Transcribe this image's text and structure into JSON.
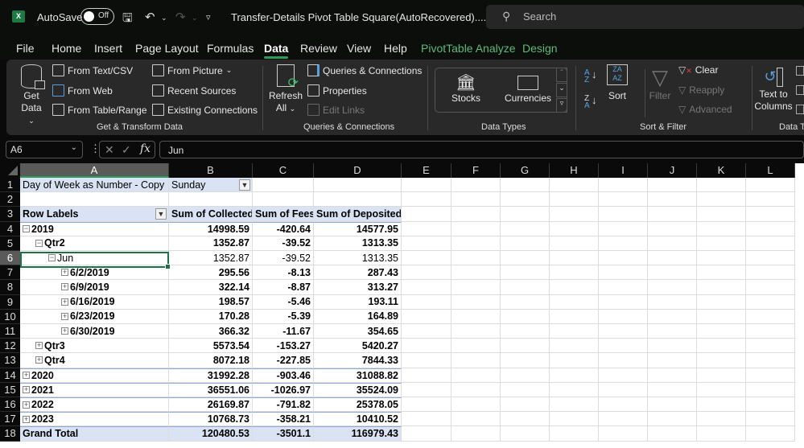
{
  "titlebar": {
    "app_icon": "excel-icon",
    "autosave_label": "AutoSave",
    "autosave_state": "Off",
    "doc_title": "Transfer-Details Pivot Table Square(AutoRecovered)....",
    "search_placeholder": "Search"
  },
  "tabs": [
    {
      "label": "File"
    },
    {
      "label": "Home"
    },
    {
      "label": "Insert"
    },
    {
      "label": "Page Layout"
    },
    {
      "label": "Formulas"
    },
    {
      "label": "Data",
      "active": true
    },
    {
      "label": "Review"
    },
    {
      "label": "View"
    },
    {
      "label": "Help"
    },
    {
      "label": "PivotTable Analyze",
      "contextual": true
    },
    {
      "label": "Design",
      "contextual": true
    }
  ],
  "ribbon": {
    "get_transform": {
      "group_label": "Get & Transform Data",
      "get_data_line1": "Get",
      "get_data_line2": "Data",
      "from_text_csv": "From Text/CSV",
      "from_web": "From Web",
      "from_table_range": "From Table/Range",
      "from_picture": "From Picture",
      "recent_sources": "Recent Sources",
      "existing_connections": "Existing Connections"
    },
    "queries": {
      "group_label": "Queries & Connections",
      "refresh_line1": "Refresh",
      "refresh_line2": "All",
      "queries_connections": "Queries & Connections",
      "properties": "Properties",
      "edit_links": "Edit Links"
    },
    "data_types": {
      "group_label": "Data Types",
      "stocks": "Stocks",
      "currencies": "Currencies"
    },
    "sort_filter": {
      "group_label": "Sort & Filter",
      "sort": "Sort",
      "filter": "Filter",
      "clear": "Clear",
      "reapply": "Reapply",
      "advanced": "Advanced"
    },
    "data_tools": {
      "group_label": "Data To",
      "text_to_columns_line1": "Text to",
      "text_to_columns_line2": "Columns"
    }
  },
  "formula_bar": {
    "name_box": "A6",
    "formula": "Jun"
  },
  "columns": [
    "A",
    "B",
    "C",
    "D",
    "E",
    "F",
    "G",
    "H",
    "I",
    "J",
    "K",
    "L"
  ],
  "rows": [
    "1",
    "2",
    "3",
    "4",
    "5",
    "6",
    "7",
    "8",
    "9",
    "10",
    "11",
    "12",
    "13",
    "14",
    "15",
    "16",
    "17",
    "18"
  ],
  "pivot": {
    "filter_label": "Day of Week as Number - Copy",
    "filter_value": "Sunday",
    "headers": [
      "Row Labels",
      "Sum of Collected",
      "Sum of Fees",
      "Sum of Deposited"
    ],
    "rows": [
      {
        "label": "2019",
        "collected": "14998.59",
        "fees": "-420.64",
        "deposited": "14577.95",
        "level": 0,
        "toggle": "minus",
        "bold": true
      },
      {
        "label": "Qtr2",
        "collected": "1352.87",
        "fees": "-39.52",
        "deposited": "1313.35",
        "level": 1,
        "toggle": "minus",
        "bold": true
      },
      {
        "label": "Jun",
        "collected": "1352.87",
        "fees": "-39.52",
        "deposited": "1313.35",
        "level": 2,
        "toggle": "minus",
        "bold": false
      },
      {
        "label": "6/2/2019",
        "collected": "295.56",
        "fees": "-8.13",
        "deposited": "287.43",
        "level": 3,
        "toggle": "plus",
        "bold": true
      },
      {
        "label": "6/9/2019",
        "collected": "322.14",
        "fees": "-8.87",
        "deposited": "313.27",
        "level": 3,
        "toggle": "plus",
        "bold": true
      },
      {
        "label": "6/16/2019",
        "collected": "198.57",
        "fees": "-5.46",
        "deposited": "193.11",
        "level": 3,
        "toggle": "plus",
        "bold": true
      },
      {
        "label": "6/23/2019",
        "collected": "170.28",
        "fees": "-5.39",
        "deposited": "164.89",
        "level": 3,
        "toggle": "plus",
        "bold": true
      },
      {
        "label": "6/30/2019",
        "collected": "366.32",
        "fees": "-11.67",
        "deposited": "354.65",
        "level": 3,
        "toggle": "plus",
        "bold": true
      },
      {
        "label": "Qtr3",
        "collected": "5573.54",
        "fees": "-153.27",
        "deposited": "5420.27",
        "level": 1,
        "toggle": "plus",
        "bold": true
      },
      {
        "label": "Qtr4",
        "collected": "8072.18",
        "fees": "-227.85",
        "deposited": "7844.33",
        "level": 1,
        "toggle": "plus",
        "bold": true
      },
      {
        "label": "2020",
        "collected": "31992.28",
        "fees": "-903.46",
        "deposited": "31088.82",
        "level": 0,
        "toggle": "plus",
        "bold": true
      },
      {
        "label": "2021",
        "collected": "36551.06",
        "fees": "-1026.97",
        "deposited": "35524.09",
        "level": 0,
        "toggle": "plus",
        "bold": true
      },
      {
        "label": "2022",
        "collected": "26169.87",
        "fees": "-791.82",
        "deposited": "25378.05",
        "level": 0,
        "toggle": "plus",
        "bold": true
      },
      {
        "label": "2023",
        "collected": "10768.73",
        "fees": "-358.21",
        "deposited": "10410.52",
        "level": 0,
        "toggle": "plus",
        "bold": true
      }
    ],
    "grand_total": {
      "label": "Grand Total",
      "collected": "120480.53",
      "fees": "-3501.1",
      "deposited": "116979.43"
    }
  },
  "colors": {
    "accent_green": "#2f9b5a",
    "contextual_tab": "#5cbb7a",
    "pivot_header_band": "#dae3f3",
    "selection_border": "#1e7145"
  }
}
